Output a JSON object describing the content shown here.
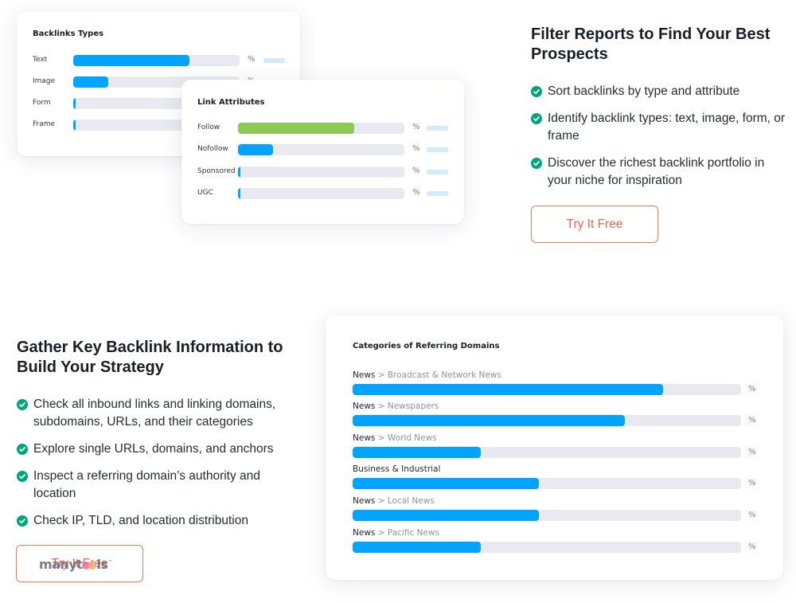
{
  "colors": {
    "bar_blue": "#00a3fe",
    "bar_green": "#8bc953",
    "track": "#e9eaef",
    "check": "#00a57c",
    "cta": "#e3694a"
  },
  "backlink_types": {
    "title": "Backlinks Types",
    "rows": [
      {
        "label": "Text",
        "fraction": 0.7,
        "pct": "%"
      },
      {
        "label": "Image",
        "fraction": 0.21,
        "pct": "%"
      },
      {
        "label": "Form",
        "fraction": 0.015,
        "pct": "%"
      },
      {
        "label": "Frame",
        "fraction": 0.015,
        "pct": "%"
      }
    ]
  },
  "link_attributes": {
    "title": "Link Attributes",
    "rows": [
      {
        "label": "Follow",
        "fraction": 0.7,
        "pct": "%",
        "color": "green"
      },
      {
        "label": "Nofollow",
        "fraction": 0.21,
        "pct": "%",
        "color": "blue"
      },
      {
        "label": "Sponsored",
        "fraction": 0.015,
        "pct": "%",
        "color": "blue"
      },
      {
        "label": "UGC",
        "fraction": 0.015,
        "pct": "%",
        "color": "blue"
      }
    ]
  },
  "section_filter": {
    "heading": "Filter Reports to Find Your Best Prospects",
    "features": [
      "Sort backlinks by type and attribute",
      "Identify backlink types: text, image, form, or frame",
      "Discover the richest backlink portfolio in your niche for inspiration"
    ],
    "cta": "Try It Free"
  },
  "section_gather": {
    "heading": "Gather Key Backlink Information to Build Your Strategy",
    "features": [
      "Check all inbound links and linking domains, subdomains, URLs, and their categories",
      "Explore single URLs, domains, and anchors",
      "Inspect a referring domain’s authority and location",
      "Check IP, TLD, and location distribution"
    ],
    "cta": "Try It Free"
  },
  "categories": {
    "title": "Categories of Referring Domains",
    "rows": [
      {
        "main": "News",
        "sub": " > Broadcast & Network News",
        "fraction": 0.8,
        "pct": "%"
      },
      {
        "main": "News",
        "sub": " > Newspapers",
        "fraction": 0.7,
        "pct": "%"
      },
      {
        "main": "News",
        "sub": " > World News",
        "fraction": 0.33,
        "pct": "%"
      },
      {
        "main": "Business & Industrial",
        "sub": "",
        "fraction": 0.48,
        "pct": "%"
      },
      {
        "main": "News",
        "sub": " > Local News",
        "fraction": 0.48,
        "pct": "%"
      },
      {
        "main": "News",
        "sub": " > Pacific News",
        "fraction": 0.33,
        "pct": "%"
      }
    ]
  },
  "watermark": {
    "text_a": "manyt",
    "text_b": "ls",
    "mark": "™"
  }
}
